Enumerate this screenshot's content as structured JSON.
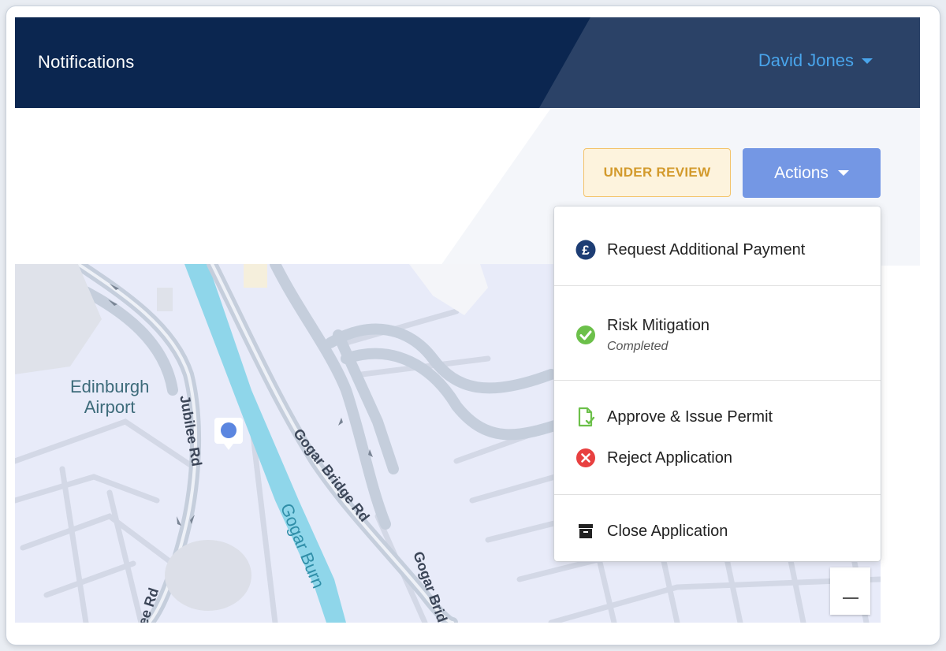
{
  "header": {
    "title": "Notifications",
    "user_name": "David Jones"
  },
  "toolbar": {
    "status_badge": "UNDER REVIEW",
    "actions_label": "Actions"
  },
  "actions_menu": {
    "items": [
      {
        "label": "Request Additional Payment",
        "icon": "pound-circle-icon"
      },
      {
        "label": "Risk Mitigation",
        "sublabel": "Completed",
        "icon": "check-circle-icon"
      },
      {
        "label": "Approve & Issue Permit",
        "icon": "document-check-icon"
      },
      {
        "label": "Reject Application",
        "icon": "x-circle-icon"
      },
      {
        "label": "Close Application",
        "icon": "archive-box-icon"
      }
    ]
  },
  "map": {
    "labels": {
      "airport": "Edinburgh\nAirport",
      "jubilee_rd": "Jubilee Rd",
      "gogar_bridge_rd": "Gogar Bridge Rd",
      "gogar_burn": "Gogar Burn",
      "gogar_brid": "Gogar Brid",
      "ee_rd": "ee Rd"
    },
    "zoom_out_label": "—"
  },
  "colors": {
    "header_bg": "#0b2650",
    "header_accent": "#2b4267",
    "user_name": "#49a5ec",
    "badge_bg": "#fdf3dd",
    "badge_text": "#d39a2c",
    "actions_bg": "#7497e4",
    "map_bg": "#e8ebf9",
    "water": "#8fd6ea",
    "road": "#c9d1de"
  }
}
